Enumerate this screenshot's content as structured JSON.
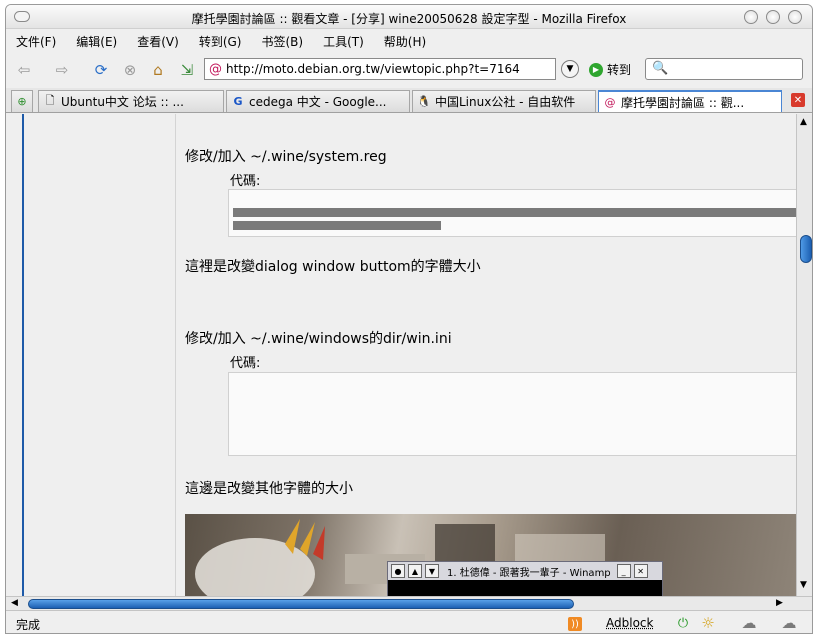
{
  "window": {
    "title": "摩托學園討論區 :: 觀看文章 - [分享] wine20050628 設定字型 - Mozilla Firefox"
  },
  "menubar": {
    "items": [
      "文件(F)",
      "编辑(E)",
      "查看(V)",
      "转到(G)",
      "书签(B)",
      "工具(T)",
      "帮助(H)"
    ]
  },
  "navbar": {
    "url": "http://moto.debian.org.tw/viewtopic.php?t=7164",
    "go_label": "转到",
    "icons": [
      "back-arrow-icon",
      "forward-arrow-icon",
      "reload-icon",
      "stop-icon",
      "home-icon",
      "bookmark-add-icon"
    ]
  },
  "tabs": [
    {
      "label": "Ubuntu中文 论坛 :: ...",
      "icon": "page-icon"
    },
    {
      "label": "cedega 中文 - Google...",
      "icon": "google-icon"
    },
    {
      "label": "中国Linux公社 - 自由软件",
      "icon": "penguin-icon"
    },
    {
      "label": "摩托學園討論區 :: 觀...",
      "icon": "debian-swirl-icon",
      "active": true
    }
  ],
  "content": {
    "line1": "修改/加入 ~/.wine/system.reg",
    "code_label": "代碼:",
    "line2": "這裡是改變dialog window buttom的字體大小",
    "line3": "修改/加入 ~/.wine/windows的dir/win.ini",
    "code_label_2": "代碼:",
    "line4": "這邊是改變其他字體的大小"
  },
  "winamp": {
    "title": "1. 杜德偉 - 跟著我一輩子 - Winamp"
  },
  "statusbar": {
    "status": "完成",
    "adblock": "Adblock"
  },
  "colors": {
    "accent": "#1e5aa8",
    "scroll_thumb": "#2a74c9",
    "close_tab": "#d83a2c"
  }
}
